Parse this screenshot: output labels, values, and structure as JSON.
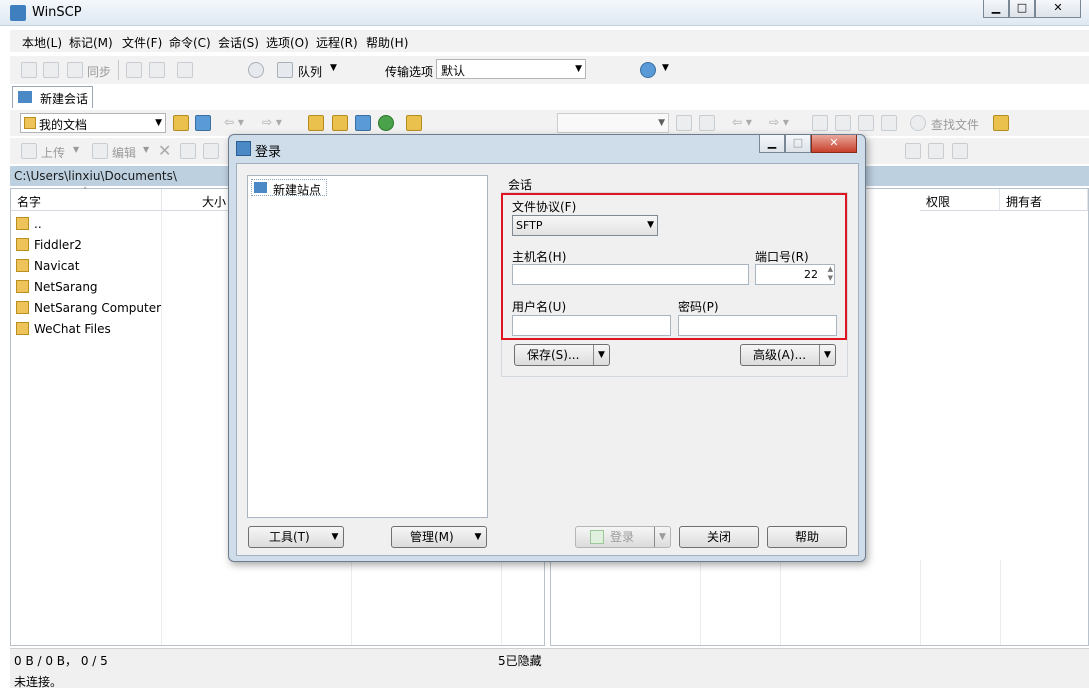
{
  "window": {
    "title": "WinSCP"
  },
  "menu": [
    "本地(L)",
    "标记(M)",
    "文件(F)",
    "命令(C)",
    "会话(S)",
    "选项(O)",
    "远程(R)",
    "帮助(H)"
  ],
  "toolbar1": {
    "sync": "同步",
    "queue": "队列",
    "transfer_label": "传输选项",
    "transfer_value": "默认"
  },
  "tabs": {
    "new_session": "新建会话"
  },
  "left_panel": {
    "location": "我的文档",
    "upload": "上传",
    "edit": "编辑",
    "path": "C:\\Users\\linxiu\\Documents\\",
    "columns": {
      "name": "名字",
      "size": "大小"
    },
    "files": [
      "..",
      "Fiddler2",
      "Navicat",
      "NetSarang",
      "NetSarang Computer",
      "WeChat Files"
    ]
  },
  "right_panel": {
    "find_files": "查找文件",
    "columns": {
      "permissions": "权限",
      "owner": "拥有者"
    }
  },
  "status": {
    "left_counts": "0 B / 0 B， 0 / 5",
    "hidden": "5已隐藏",
    "connection": "未连接。"
  },
  "dialog": {
    "title": "登录",
    "site_tree": [
      "新建站点"
    ],
    "session_group": "会话",
    "protocol_label": "文件协议(F)",
    "protocol_value": "SFTP",
    "host_label": "主机名(H)",
    "host_value": "",
    "port_label": "端口号(R)",
    "port_value": "22",
    "user_label": "用户名(U)",
    "user_value": "",
    "password_label": "密码(P)",
    "password_value": "",
    "save_button": "保存(S)...",
    "advanced_button": "高级(A)...",
    "tools_button": "工具(T)",
    "manage_button": "管理(M)",
    "login_button": "登录",
    "close_button": "关闭",
    "help_button": "帮助"
  },
  "colors": {
    "highlight": "#e0141e",
    "pathbar": "#bdd0e0",
    "dialog_frame": "#cfdcea"
  }
}
